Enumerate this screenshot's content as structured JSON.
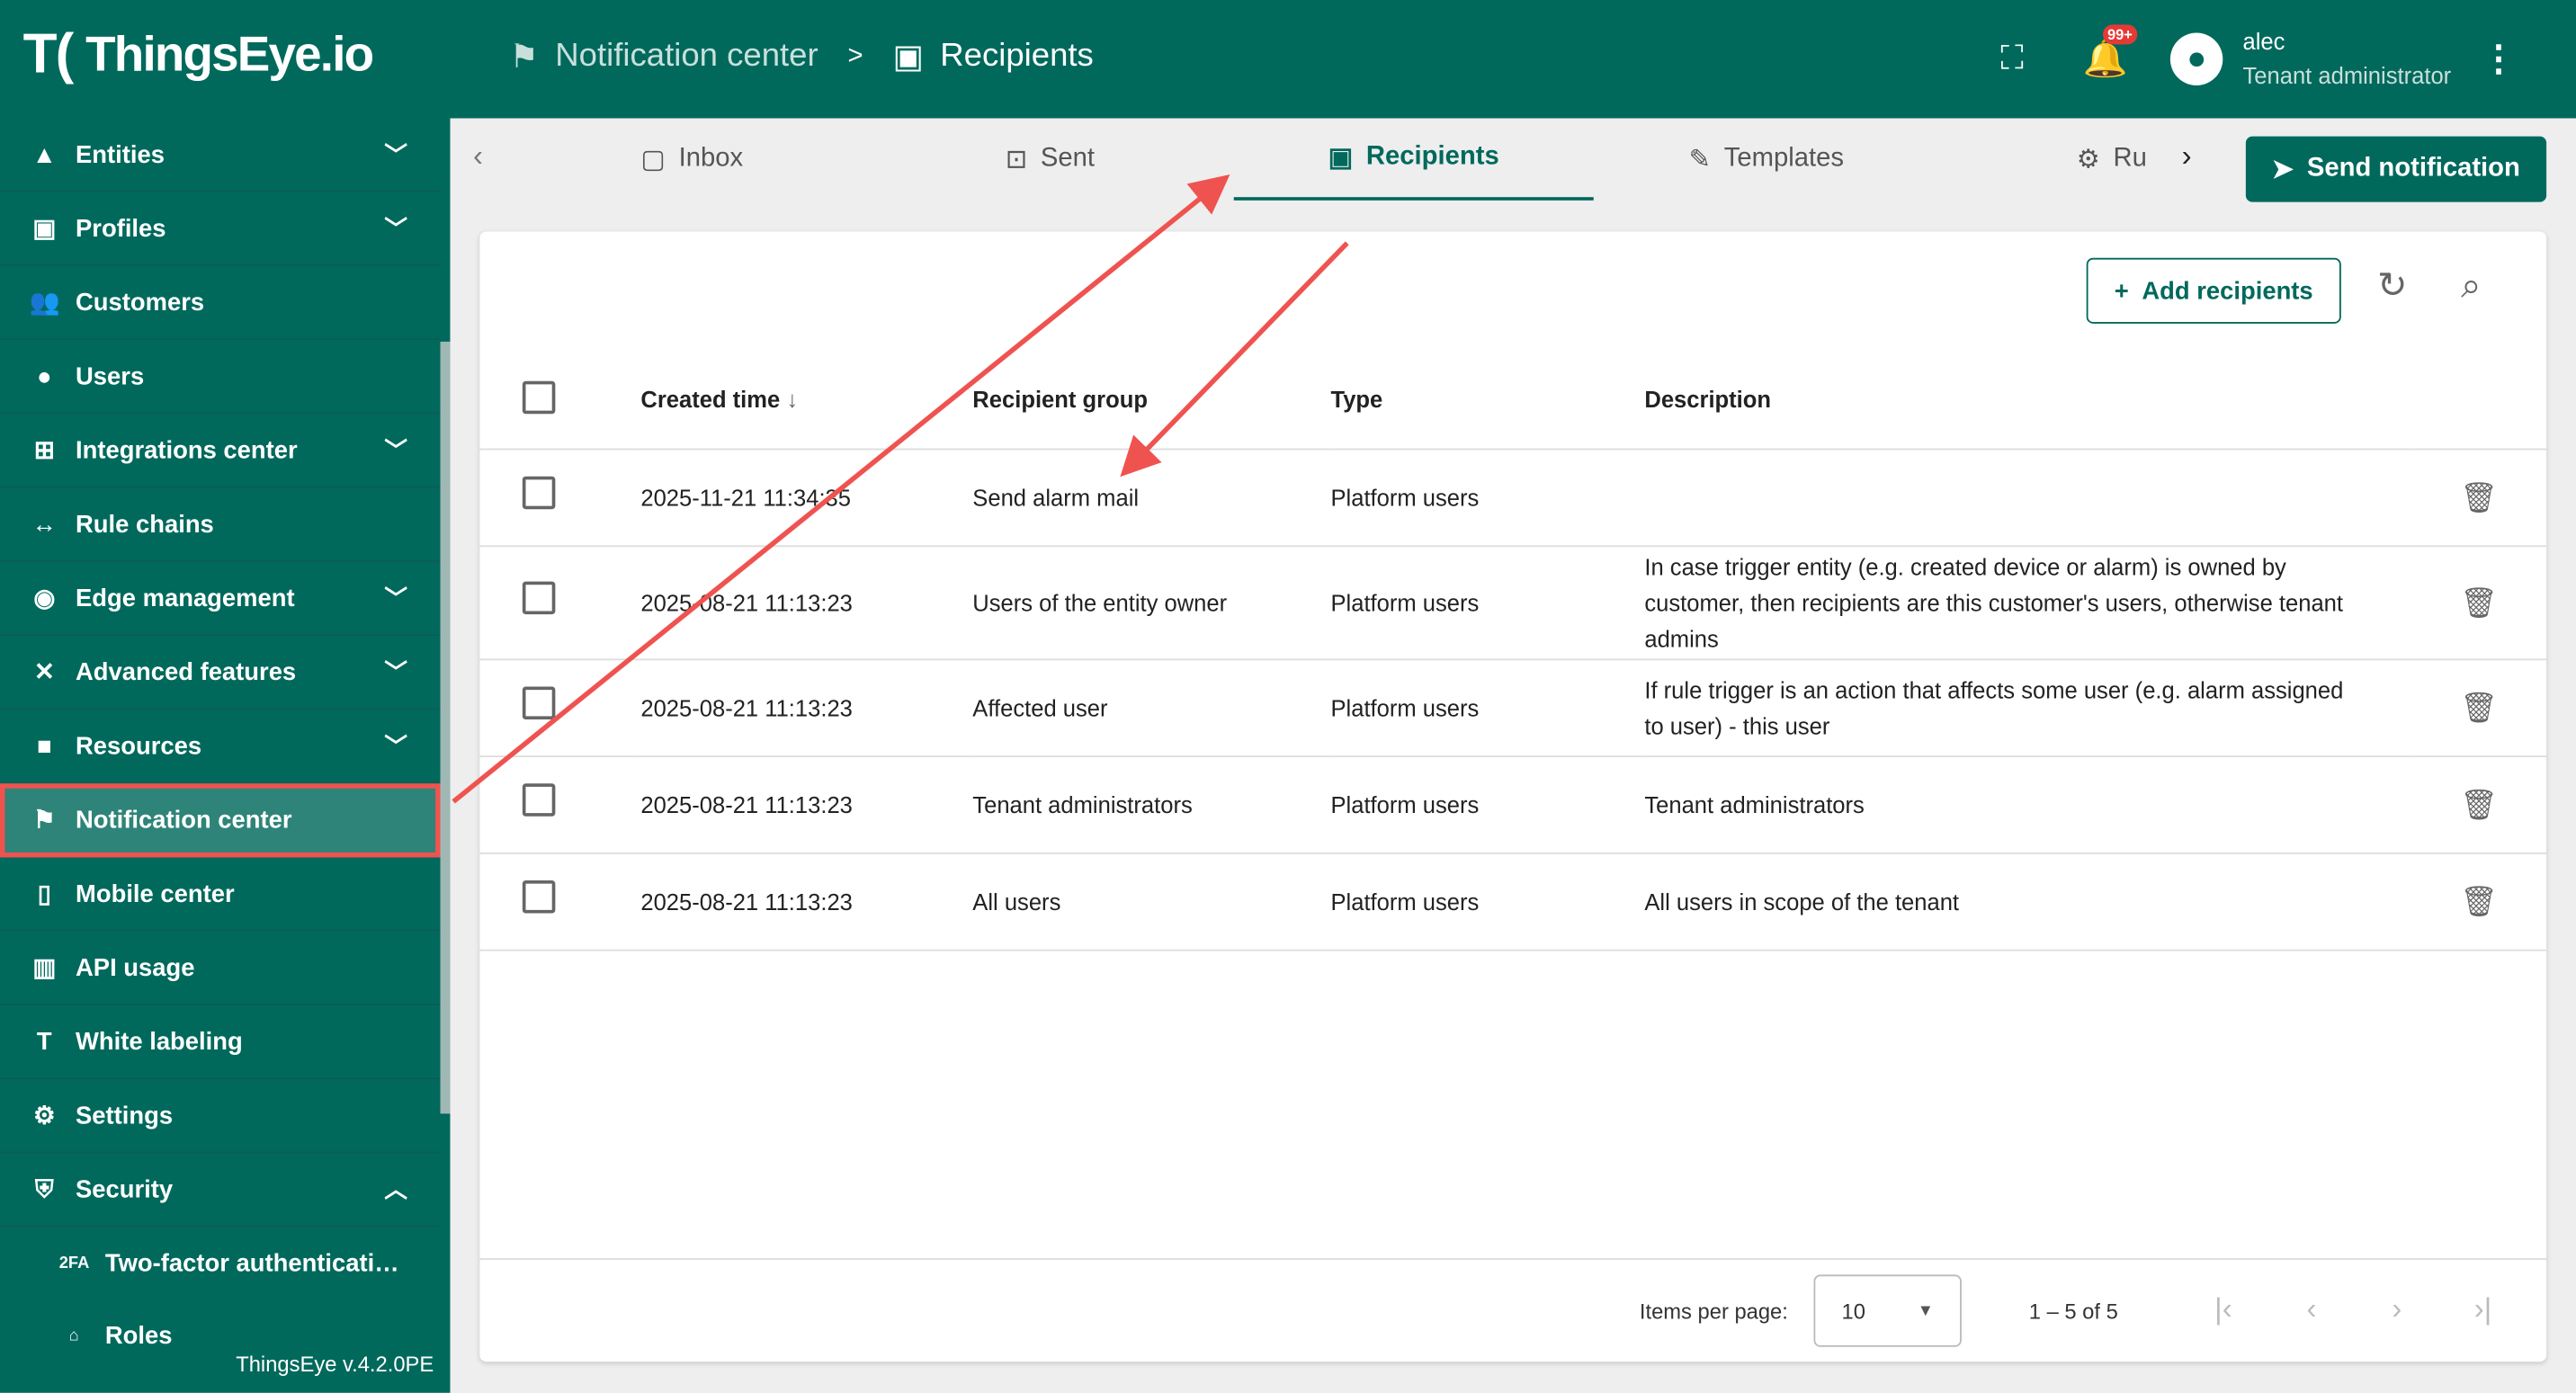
{
  "header": {
    "logo": "ThingsEye.io",
    "breadcrumb": [
      {
        "label": "Notification center",
        "icon": "notification-icon"
      },
      {
        "label": "Recipients",
        "icon": "contact-icon"
      }
    ],
    "separator": ">",
    "notification_badge": "99+",
    "user": {
      "name": "alec",
      "role": "Tenant administrator"
    }
  },
  "sidebar": {
    "items": [
      {
        "label": "Entities",
        "icon": "▲",
        "expand": "down"
      },
      {
        "label": "Profiles",
        "icon": "▣",
        "expand": "down"
      },
      {
        "label": "Customers",
        "icon": "👥"
      },
      {
        "label": "Users",
        "icon": "●"
      },
      {
        "label": "Integrations center",
        "icon": "⊞",
        "expand": "down"
      },
      {
        "label": "Rule chains",
        "icon": "↔"
      },
      {
        "label": "Edge management",
        "icon": "◉",
        "expand": "down"
      },
      {
        "label": "Advanced features",
        "icon": "✕",
        "expand": "down"
      },
      {
        "label": "Resources",
        "icon": "■",
        "expand": "down"
      },
      {
        "label": "Notification center",
        "icon": "⚑",
        "active": true
      },
      {
        "label": "Mobile center",
        "icon": "▯"
      },
      {
        "label": "API usage",
        "icon": "▥"
      },
      {
        "label": "White labeling",
        "icon": "T"
      },
      {
        "label": "Settings",
        "icon": "⚙"
      },
      {
        "label": "Security",
        "icon": "⛨",
        "expand": "up"
      },
      {
        "label": "Two-factor authenticati…",
        "icon": "2FA",
        "sub": true
      },
      {
        "label": "Roles",
        "icon": "⌂",
        "sub": true
      }
    ],
    "version": "ThingsEye v.4.2.0PE"
  },
  "tabs": [
    {
      "label": "Inbox",
      "icon": "inbox-icon"
    },
    {
      "label": "Sent",
      "icon": "sent-icon"
    },
    {
      "label": "Recipients",
      "icon": "contact-icon",
      "active": true
    },
    {
      "label": "Templates",
      "icon": "template-icon"
    },
    {
      "label": "Ru",
      "icon": "rule-icon"
    }
  ],
  "send_notification": "Send notification",
  "add_recipients": "Add recipients",
  "table": {
    "columns": [
      "Created time",
      "Recipient group",
      "Type",
      "Description"
    ],
    "rows": [
      {
        "created": "2025-11-21 11:34:35",
        "group": "Send alarm mail",
        "type": "Platform users",
        "description": ""
      },
      {
        "created": "2025-08-21 11:13:23",
        "group": "Users of the entity owner",
        "type": "Platform users",
        "description": "In case trigger entity (e.g. created device or alarm) is owned by customer, then recipients are this customer's users, otherwise tenant admins"
      },
      {
        "created": "2025-08-21 11:13:23",
        "group": "Affected user",
        "type": "Platform users",
        "description": "If rule trigger is an action that affects some user (e.g. alarm assigned to user) - this user"
      },
      {
        "created": "2025-08-21 11:13:23",
        "group": "Tenant administrators",
        "type": "Platform users",
        "description": "Tenant administrators"
      },
      {
        "created": "2025-08-21 11:13:23",
        "group": "All users",
        "type": "Platform users",
        "description": "All users in scope of the tenant"
      }
    ]
  },
  "paginator": {
    "label": "Items per page:",
    "page_size": "10",
    "range": "1 – 5 of 5"
  },
  "colors": {
    "primary": "#00695c",
    "annotation": "#ef5350"
  }
}
